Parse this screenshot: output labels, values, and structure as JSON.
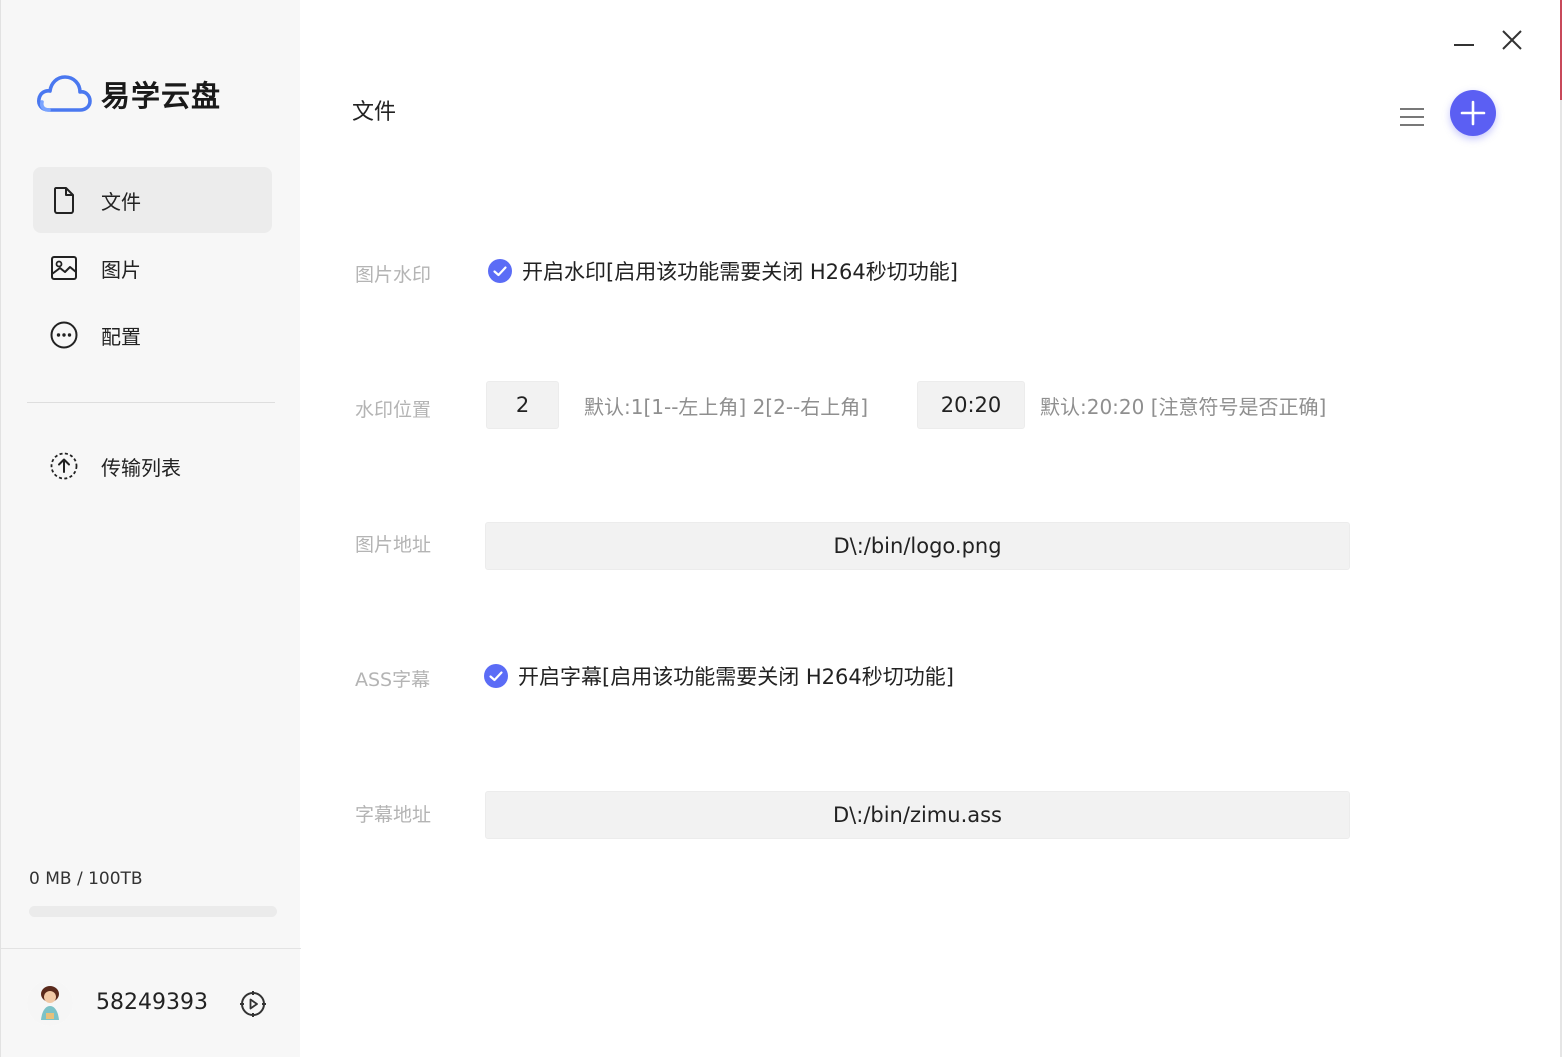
{
  "app": {
    "name": "易学云盘"
  },
  "sidebar": {
    "items": [
      {
        "label": "文件",
        "icon": "file-icon",
        "active": true
      },
      {
        "label": "图片",
        "icon": "image-icon",
        "active": false
      },
      {
        "label": "配置",
        "icon": "more-circle-icon",
        "active": false
      },
      {
        "label": "传输列表",
        "icon": "upload-circle-icon",
        "active": false
      }
    ],
    "storage": {
      "text": "0 MB / 100TB",
      "used_fraction": 0
    },
    "user": {
      "id": "58249393"
    }
  },
  "main": {
    "title": "文件",
    "fields": {
      "watermark": {
        "label": "图片水印",
        "checkbox_text": "开启水印[启用该功能需要关闭 H264秒切功能]",
        "checked": true
      },
      "position": {
        "label": "水印位置",
        "position_value": "2",
        "position_hint": "默认:1[1--左上角] 2[2--右上角]",
        "offset_value": "20:20",
        "offset_hint": "默认:20:20 [注意符号是否正确]"
      },
      "image_path": {
        "label": "图片地址",
        "value": "D\\:/bin/logo.png"
      },
      "ass": {
        "label": "ASS字幕",
        "checkbox_text": "开启字幕[启用该功能需要关闭 H264秒切功能]",
        "checked": true
      },
      "subtitle_path": {
        "label": "字幕地址",
        "value": "D\\:/bin/zimu.ass"
      }
    }
  },
  "colors": {
    "accent": "#5b5ff3",
    "sidebar_bg": "#f7f7f7",
    "label_gray": "#b4b4b4"
  }
}
